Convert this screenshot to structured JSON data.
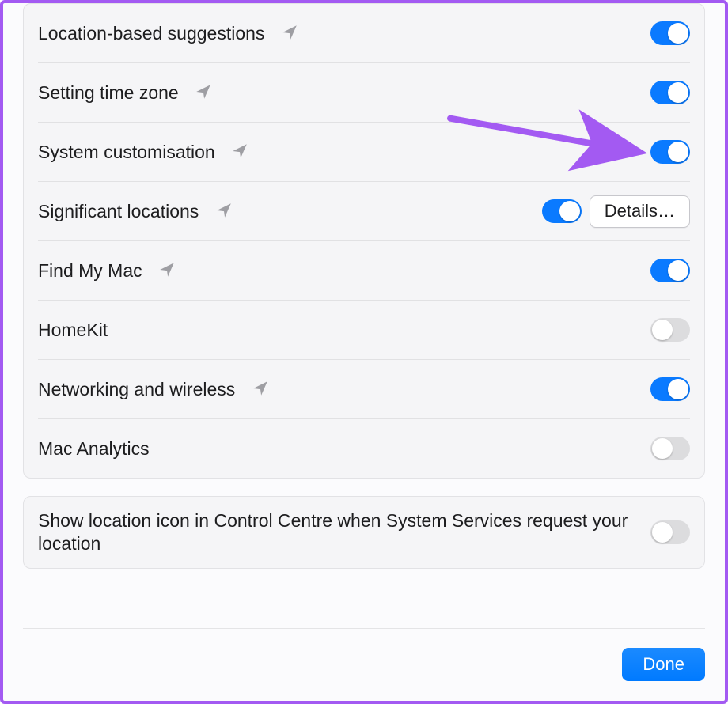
{
  "settings": [
    {
      "key": "location-suggestions",
      "label": "Location-based suggestions",
      "icon": true,
      "enabled": true,
      "details": false
    },
    {
      "key": "setting-time-zone",
      "label": "Setting time zone",
      "icon": true,
      "enabled": true,
      "details": false
    },
    {
      "key": "system-customisation",
      "label": "System customisation",
      "icon": true,
      "enabled": true,
      "details": false
    },
    {
      "key": "significant-locations",
      "label": "Significant locations",
      "icon": true,
      "enabled": true,
      "details": true,
      "details_label": "Details…"
    },
    {
      "key": "find-my-mac",
      "label": "Find My Mac",
      "icon": true,
      "enabled": true,
      "details": false
    },
    {
      "key": "homekit",
      "label": "HomeKit",
      "icon": false,
      "enabled": false,
      "details": false
    },
    {
      "key": "networking-and-wireless",
      "label": "Networking and wireless",
      "icon": true,
      "enabled": true,
      "details": false
    },
    {
      "key": "mac-analytics",
      "label": "Mac Analytics",
      "icon": false,
      "enabled": false,
      "details": false
    }
  ],
  "show_location_row": {
    "label": "Show location icon in Control Centre when System Services request your location",
    "enabled": false
  },
  "footer": {
    "done_label": "Done"
  },
  "colors": {
    "accent": "#007aff",
    "annotation": "#a35af2"
  }
}
